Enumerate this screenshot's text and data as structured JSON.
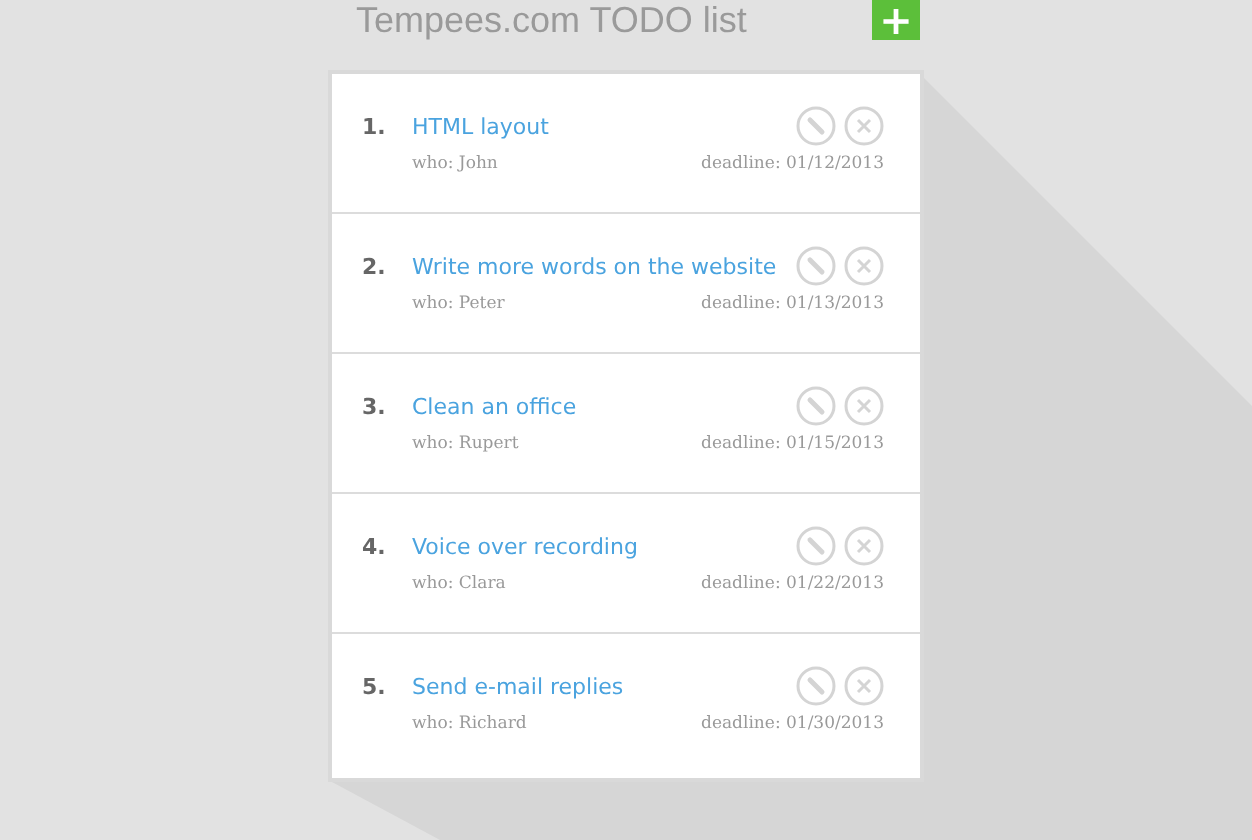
{
  "header": {
    "title": "Tempees.com TODO list",
    "add_button": "+"
  },
  "tasks": [
    {
      "number": "1.",
      "title": "HTML layout",
      "who": "who: John",
      "deadline": "deadline: 01/12/2013"
    },
    {
      "number": "2.",
      "title": "Write more words on the website",
      "who": "who: Peter",
      "deadline": "deadline: 01/13/2013"
    },
    {
      "number": "3.",
      "title": "Clean an office",
      "who": "who: Rupert",
      "deadline": "deadline: 01/15/2013"
    },
    {
      "number": "4.",
      "title": "Voice over recording",
      "who": "who: Clara",
      "deadline": "deadline: 01/22/2013"
    },
    {
      "number": "5.",
      "title": "Send e-mail replies",
      "who": "who: Richard",
      "deadline": "deadline: 01/30/2013"
    }
  ]
}
